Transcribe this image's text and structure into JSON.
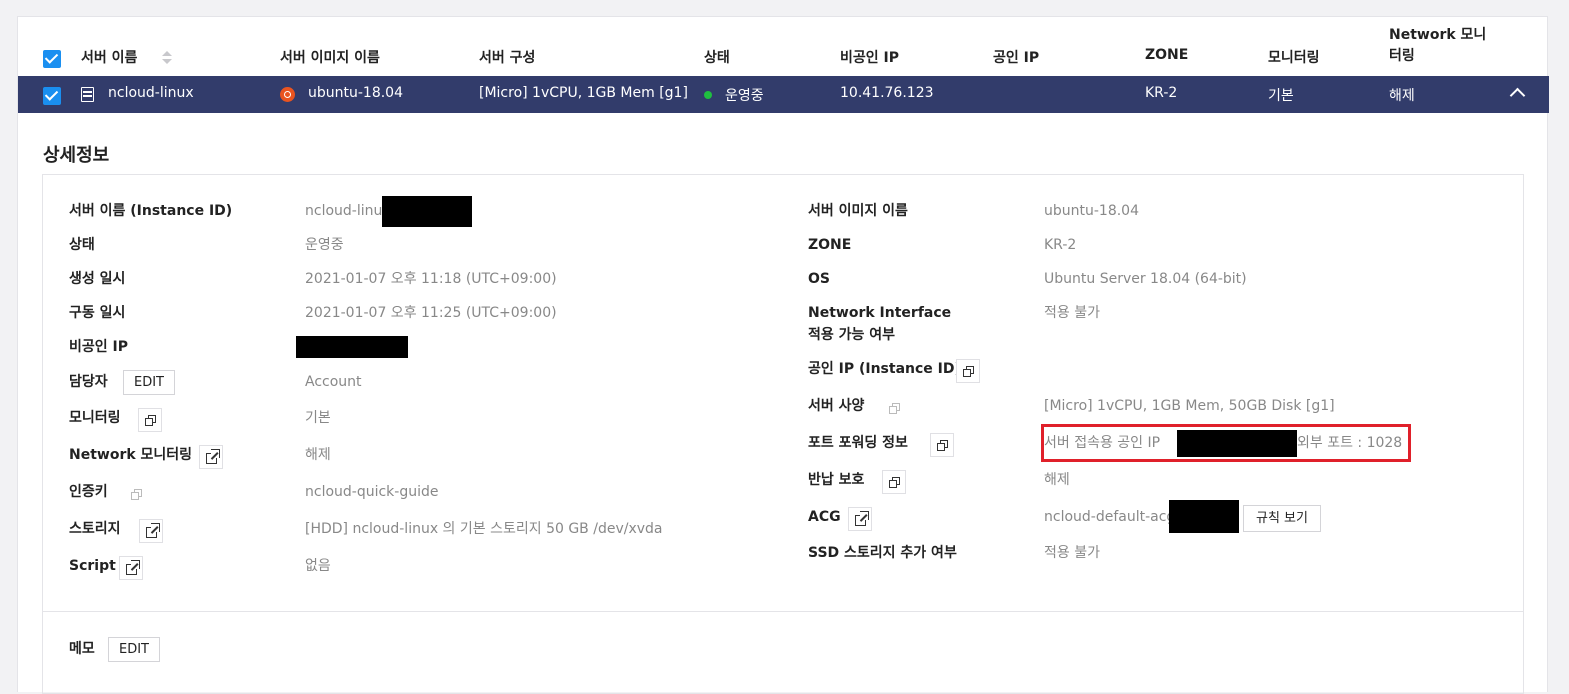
{
  "table": {
    "headers": {
      "server_name": "서버 이름",
      "server_image": "서버 이미지 이름",
      "server_spec": "서버 구성",
      "status": "상태",
      "private_ip": "비공인 IP",
      "public_ip": "공인 IP",
      "zone": "ZONE",
      "monitoring": "모니터링",
      "network_monitoring": "Network 모니터링"
    },
    "row": {
      "server_name": "ncloud-linux",
      "server_image": "ubuntu-18.04",
      "server_spec": "[Micro] 1vCPU, 1GB Mem [g1]",
      "status": "운영중",
      "private_ip": "10.41.76.123",
      "public_ip": "",
      "zone": "KR-2",
      "monitoring": "기본",
      "network_monitoring": "해제"
    }
  },
  "detail": {
    "title": "상세정보",
    "left": [
      {
        "label": "서버 이름 (Instance ID)",
        "value": "ncloud-linux"
      },
      {
        "label": "상태",
        "value": "운영중"
      },
      {
        "label": "생성 일시",
        "value": "2021-01-07 오후 11:18 (UTC+09:00)"
      },
      {
        "label": "구동 일시",
        "value": "2021-01-07 오후 11:25 (UTC+09:00)"
      },
      {
        "label": "비공인 IP",
        "value": ""
      },
      {
        "label": "담당자",
        "value": "Account",
        "button": "EDIT"
      },
      {
        "label": "모니터링",
        "value": "기본"
      },
      {
        "label": "Network 모니터링",
        "value": "해제"
      },
      {
        "label": "인증키",
        "value": "ncloud-quick-guide"
      },
      {
        "label": "스토리지",
        "value": "[HDD] ncloud-linux 의 기본 스토리지  50 GB /dev/xvda"
      },
      {
        "label": "Script",
        "value": "없음"
      }
    ],
    "right": [
      {
        "label": "서버 이미지 이름",
        "value": "ubuntu-18.04"
      },
      {
        "label": "ZONE",
        "value": "KR-2"
      },
      {
        "label": "OS",
        "value": "Ubuntu Server 18.04 (64-bit)"
      },
      {
        "label": "Network Interface",
        "label2": "적용 가능 여부",
        "value": "적용 불가"
      },
      {
        "label": "공인 IP (Instance ID)",
        "value": ""
      },
      {
        "label": "서버 사양",
        "value": "[Micro] 1vCPU, 1GB Mem, 50GB Disk [g1]"
      },
      {
        "label": "포트 포워딩 정보",
        "value": "서버 접속용 공인 IP",
        "value2": "외부 포트 : 1028"
      },
      {
        "label": "반납 보호",
        "value": "해제"
      },
      {
        "label": "ACG",
        "value": "ncloud-default-acg",
        "button": "규칙 보기"
      },
      {
        "label": "SSD 스토리지 추가 여부",
        "value": "적용 불가"
      }
    ],
    "memo": {
      "label": "메모",
      "button": "EDIT"
    }
  },
  "colors": {
    "row_bg": "#323c6b",
    "checkbox": "#1a8ff0",
    "status_running": "#1fbf40",
    "highlight": "#e0202a"
  }
}
